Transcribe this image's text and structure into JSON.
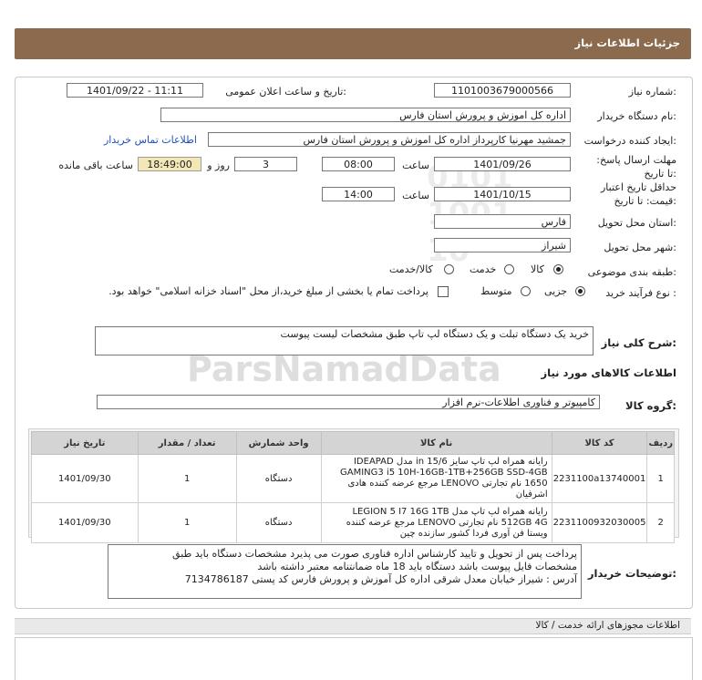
{
  "header": {
    "title": "جزئیات اطلاعات نیاز"
  },
  "fields": {
    "need_number_label": "شماره نیاز:",
    "need_number": "1101003679000566",
    "announce_label": "تاریخ و ساعت اعلان عمومی:",
    "announce_value": "1401/09/22 - 11:11",
    "buyer_org_label": "نام دستگاه خریدار:",
    "buyer_org": "اداره کل اموزش و پرورش استان فارس",
    "creator_label": "ایجاد کننده درخواست:",
    "creator": "جمشید مهرنیا کارپرداز اداره کل اموزش و پرورش استان فارس",
    "contact_link": "اطلاعات تماس خریدار",
    "deadline_label": "مهلت ارسال پاسخ: تا تاریخ:",
    "deadline_date": "1401/09/26",
    "time_label": "ساعت",
    "deadline_time": "08:00",
    "days_value": "3",
    "days_label": "روز و",
    "remaining_time": "18:49:00",
    "remaining_label": "ساعت باقی مانده",
    "validity_label": "حداقل تاریخ اعتبار قیمت: تا تاریخ:",
    "validity_date": "1401/10/15",
    "validity_time": "14:00",
    "province_label": "استان محل تحویل:",
    "province": "فارس",
    "city_label": "شهر محل تحویل:",
    "city": "شیراز",
    "category_label": "طبقه بندی موضوعی:",
    "category_options": [
      "کالا",
      "خدمت",
      "کالا/خدمت"
    ],
    "process_label": "نوع فرآیند خرید :",
    "process_options": [
      "جزیی",
      "متوسط"
    ],
    "treasury_text": "پرداخت تمام یا بخشی از مبلغ خرید،از محل \"اسناد خزانه اسلامی\" خواهد بود."
  },
  "summary": {
    "label": "شرح کلی نیاز:",
    "value": "خرید یک دستگاه تبلت و یک دستگاه لپ تاپ طبق مشخصات لیست پیوست"
  },
  "goods": {
    "section_title": "اطلاعات کالاهای مورد نیاز",
    "group_label": "گروه کالا:",
    "group_value": "کامپیوتر و فناوری اطلاعات-نرم افزار",
    "columns": [
      "ردیف",
      "کد کالا",
      "نام کالا",
      "واحد شمارش",
      "تعداد / مقدار",
      "تاریخ نیاز"
    ],
    "rows": [
      {
        "index": "1",
        "code": "2231100a13740001",
        "name": "رایانه همراه لپ تاپ سایز in 15/6 مدل IDEAPAD GAMING3 i5 10H-16GB-1TB+256GB SSD-4GB 1650 نام تجارتی LENOVO مرجع عرضه کننده هادی اشرفیان",
        "unit": "دستگاه",
        "qty": "1",
        "date": "1401/09/30"
      },
      {
        "index": "2",
        "code": "2231100932030005",
        "name": "رایانه همراه لپ تاپ مدل LEGION 5 I7 16G 1TB 512GB 4G نام تجارتی LENOVO مرجع عرضه کننده ویستا فن آوری فردا کشور سازنده چین",
        "unit": "دستگاه",
        "qty": "1",
        "date": "1401/09/30"
      }
    ]
  },
  "buyer_notes": {
    "label": "توضیحات خریدار:",
    "lines": [
      "پرداخت پس از تحویل و تایید کارشناس اداره فناوری صورت می پذیرد مشخصات دستگاه باید طبق",
      "مشخصات فایل پیوست باشد دستگاه باید 18 ماه ضمانتنامه معتبر داشته باشد",
      "آدرس : شیراز خیابان معدل شرقی اداره کل آموزش و پرورش فارس  کد پستی 7134786187"
    ]
  },
  "footer": {
    "title": "اطلاعات مجوزهای ارائه خدمت / کالا"
  },
  "watermark": {
    "text": "ParsNamadData"
  },
  "colors": {
    "header_bg": "#8b6a4d",
    "highlight": "#f3e7b6",
    "link": "#1f4fbf"
  }
}
